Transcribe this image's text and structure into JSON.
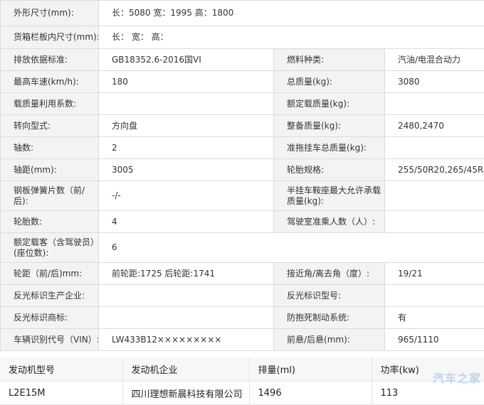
{
  "spec": {
    "dims_label": "外形尺寸(mm):",
    "dims_value": "长：5080 宽：1995 高：1800",
    "cargo_label": "货箱栏板内尺寸(mm):",
    "cargo_value": "长：  宽：  高：",
    "rows": [
      {
        "l1": "排放依据标准:",
        "v1": "GB18352.6-2016国VI",
        "l2": "燃料种类:",
        "v2": "汽油/电混合动力"
      },
      {
        "l1": "最高车速(km/h):",
        "v1": "180",
        "l2": "总质量(kg):",
        "v2": "3080"
      },
      {
        "l1": "载质量利用系数:",
        "v1": "",
        "l2": "额定载质量(kg):",
        "v2": ""
      },
      {
        "l1": "转向型式:",
        "v1": "方向盘",
        "l2": "整备质量(kg):",
        "v2": "2480,2470"
      },
      {
        "l1": "轴数:",
        "v1": "2",
        "l2": "准拖挂车总质量(kg):",
        "v2": ""
      },
      {
        "l1": "轴距(mm):",
        "v1": "3005",
        "l2": "轮胎规格:",
        "v2": "255/50R20,265/45R21"
      },
      {
        "l1": "钢板弹簧片数（前/后):",
        "v1": "-/-",
        "l2": "半挂车鞍座最大允许承载质量(kg):",
        "v2": ""
      },
      {
        "l1": "轮胎数:",
        "v1": "4",
        "l2": "驾驶室准乘人数（人）:",
        "v2": ""
      }
    ],
    "seats_label": "额定载客（含驾驶员）(座位数):",
    "seats_value": "6",
    "rows2": [
      {
        "l1": "轮距（前/后)mm:",
        "v1": "前轮距:1725 后轮距:1741",
        "l2": "接近角/离去角（度）:",
        "v2": "19/21"
      },
      {
        "l1": "反光标识生产企业:",
        "v1": "",
        "l2": "反光标识型号:",
        "v2": ""
      },
      {
        "l1": "反光标识商标:",
        "v1": "",
        "l2": "防抱死制动系统:",
        "v2": "有"
      },
      {
        "l1": "车辆识别代号（VIN）:",
        "v1": "LW433B12×××××××××",
        "l2": "前悬/后悬(mm):",
        "v2": "965/1110"
      }
    ]
  },
  "engine": {
    "headers": [
      "发动机型号",
      "发动机企业",
      "排量(ml)",
      "功率(kw)"
    ],
    "row": [
      "L2E15M",
      "四川理想新晨科技有限公司",
      "1496",
      "113"
    ]
  },
  "watermark": "汽车之家"
}
